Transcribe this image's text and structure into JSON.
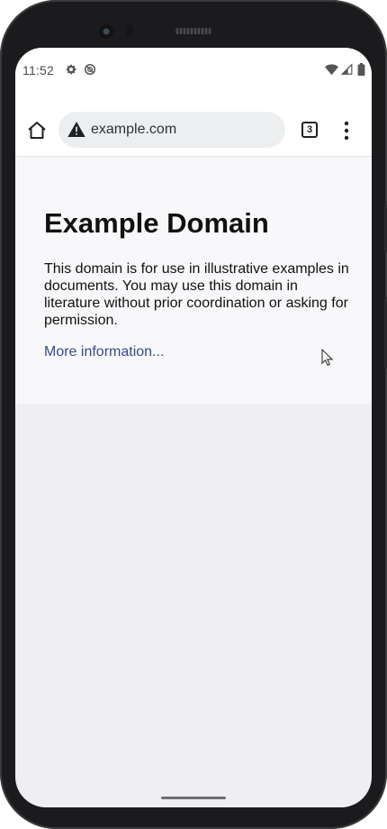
{
  "status_bar": {
    "time": "11:52",
    "left_icons": [
      "gear-icon",
      "do-not-disturb-icon"
    ],
    "right_icons": [
      "wifi-icon",
      "signal-icon",
      "battery-icon"
    ]
  },
  "toolbar": {
    "url": "example.com",
    "tab_count": "3"
  },
  "page": {
    "title": "Example Domain",
    "description": "This domain is for use in illustrative examples in documents. You may use this domain in literature without prior coordination or asking for permission.",
    "link_text": "More information..."
  },
  "colors": {
    "link": "#38488f",
    "page_background": "#f8f8fb",
    "viewport_background": "#efeff2"
  }
}
